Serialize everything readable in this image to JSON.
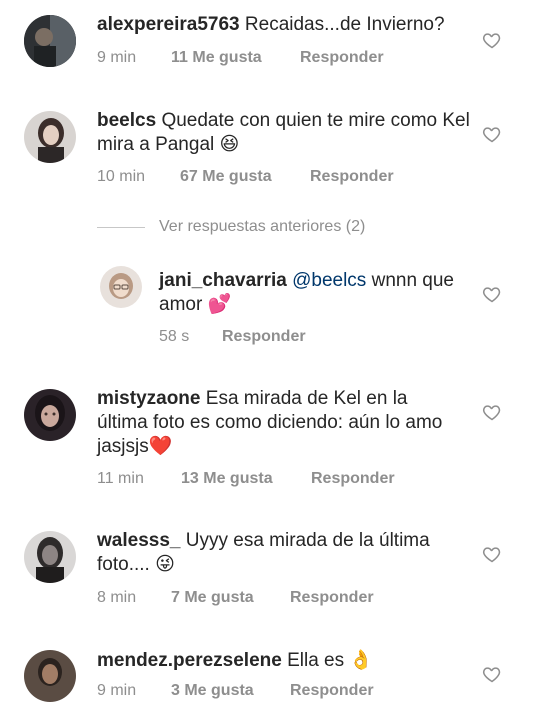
{
  "comments": [
    {
      "username": "alexpereira5763",
      "text": "Recaidas...de Invierno?",
      "time": "9 min",
      "likes": "11 Me gusta",
      "reply": "Responder",
      "avatar_color": "#3a3d40"
    },
    {
      "username": "beelcs",
      "text": "Quedate con quien te mire como Kel mira a Pangal 😆",
      "time": "10 min",
      "likes": "67 Me gusta",
      "reply": "Responder",
      "avatar_color": "#b8b1ad"
    },
    {
      "username": "mistyzaone",
      "text": "Esa mirada de Kel en la última foto es como diciendo: aún lo amo jasjsjs❤️",
      "time": "11 min",
      "likes": "13 Me gusta",
      "reply": "Responder",
      "avatar_color": "#3a2f3b"
    },
    {
      "username": "walesss_",
      "text": "Uyyy esa mirada de la última foto.... 😜",
      "time": "8 min",
      "likes": "7 Me gusta",
      "reply": "Responder",
      "avatar_color": "#6c6a6a"
    },
    {
      "username": "mendez.perezselene",
      "text": "Ella es 👌",
      "time": "9 min",
      "likes": "3 Me gusta",
      "reply": "Responder",
      "avatar_color": "#4b4038"
    }
  ],
  "thread": {
    "view_previous": "Ver respuestas anteriores (2)"
  },
  "reply": {
    "username": "jani_chavarria",
    "mention": "@beelcs",
    "text": "wnnn que amor 💕",
    "time": "58 s",
    "reply": "Responder",
    "avatar_color": "#d9cfc6"
  },
  "colors": {
    "text": "#262626",
    "meta": "#8e8e8e",
    "mention": "#00376b",
    "heart_outline": "#8e8e8e"
  }
}
